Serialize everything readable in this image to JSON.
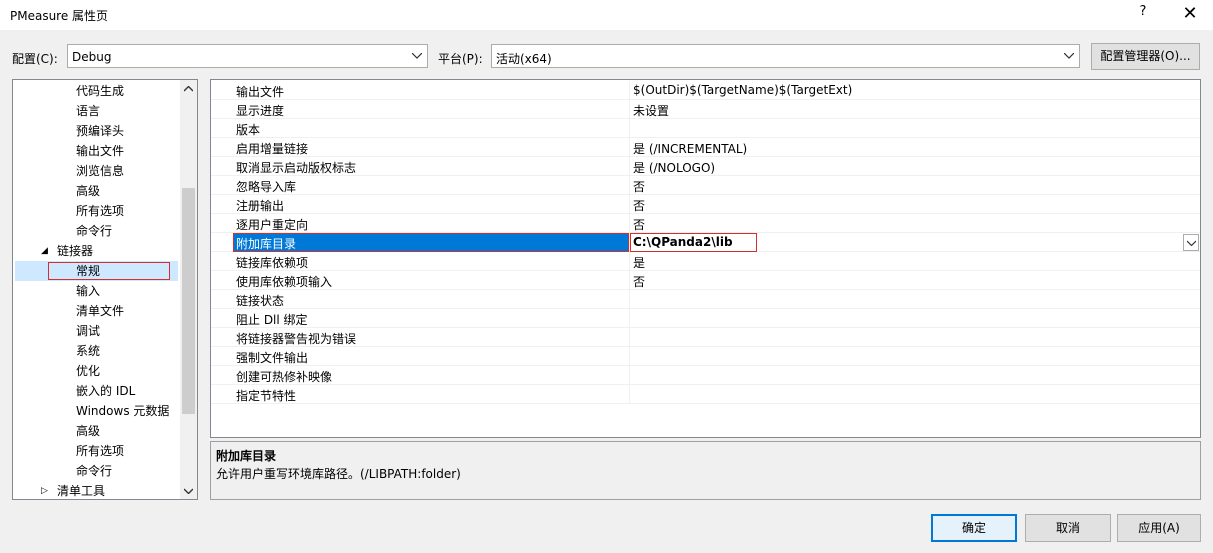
{
  "window": {
    "title": "PMeasure 属性页",
    "help_glyph": "?",
    "close_glyph": "✕"
  },
  "toolbar": {
    "config_label": "配置(C):",
    "config_value": "Debug",
    "platform_label": "平台(P):",
    "platform_value": "活动(x64)",
    "config_manager_label": "配置管理器(O)..."
  },
  "tree": {
    "items": [
      {
        "label": "代码生成",
        "indent": 2
      },
      {
        "label": "语言",
        "indent": 2
      },
      {
        "label": "预编译头",
        "indent": 2
      },
      {
        "label": "输出文件",
        "indent": 2
      },
      {
        "label": "浏览信息",
        "indent": 2
      },
      {
        "label": "高级",
        "indent": 2
      },
      {
        "label": "所有选项",
        "indent": 2
      },
      {
        "label": "命令行",
        "indent": 2
      },
      {
        "label": "链接器",
        "indent": 1,
        "expander": "◢"
      },
      {
        "label": "常规",
        "indent": 2,
        "selected": true
      },
      {
        "label": "输入",
        "indent": 2
      },
      {
        "label": "清单文件",
        "indent": 2
      },
      {
        "label": "调试",
        "indent": 2
      },
      {
        "label": "系统",
        "indent": 2
      },
      {
        "label": "优化",
        "indent": 2
      },
      {
        "label": "嵌入的 IDL",
        "indent": 2
      },
      {
        "label": "Windows 元数据",
        "indent": 2
      },
      {
        "label": "高级",
        "indent": 2
      },
      {
        "label": "所有选项",
        "indent": 2
      },
      {
        "label": "命令行",
        "indent": 2
      },
      {
        "label": "清单工具",
        "indent": 1,
        "expander": "▷"
      }
    ]
  },
  "grid": {
    "rows": [
      {
        "name": "输出文件",
        "value": "$(OutDir)$(TargetName)$(TargetExt)"
      },
      {
        "name": "显示进度",
        "value": "未设置"
      },
      {
        "name": "版本",
        "value": ""
      },
      {
        "name": "启用增量链接",
        "value": "是 (/INCREMENTAL)"
      },
      {
        "name": "取消显示启动版权标志",
        "value": "是 (/NOLOGO)"
      },
      {
        "name": "忽略导入库",
        "value": "否"
      },
      {
        "name": "注册输出",
        "value": "否"
      },
      {
        "name": "逐用户重定向",
        "value": "否"
      },
      {
        "name": "附加库目录",
        "value": "C:\\QPanda2\\lib",
        "selected": true
      },
      {
        "name": "链接库依赖项",
        "value": "是"
      },
      {
        "name": "使用库依赖项输入",
        "value": "否"
      },
      {
        "name": "链接状态",
        "value": ""
      },
      {
        "name": "阻止 Dll 绑定",
        "value": ""
      },
      {
        "name": "将链接器警告视为错误",
        "value": ""
      },
      {
        "name": "强制文件输出",
        "value": ""
      },
      {
        "name": "创建可热修补映像",
        "value": ""
      },
      {
        "name": "指定节特性",
        "value": ""
      }
    ]
  },
  "description": {
    "title": "附加库目录",
    "text": "允许用户重写环境库路径。(/LIBPATH:folder)"
  },
  "footer": {
    "ok_label": "确定",
    "cancel_label": "取消",
    "apply_label": "应用(A)"
  },
  "colors": {
    "accent": "#0078d7",
    "highlight_border": "#d32f2f",
    "selected_tree": "#cde8ff"
  }
}
